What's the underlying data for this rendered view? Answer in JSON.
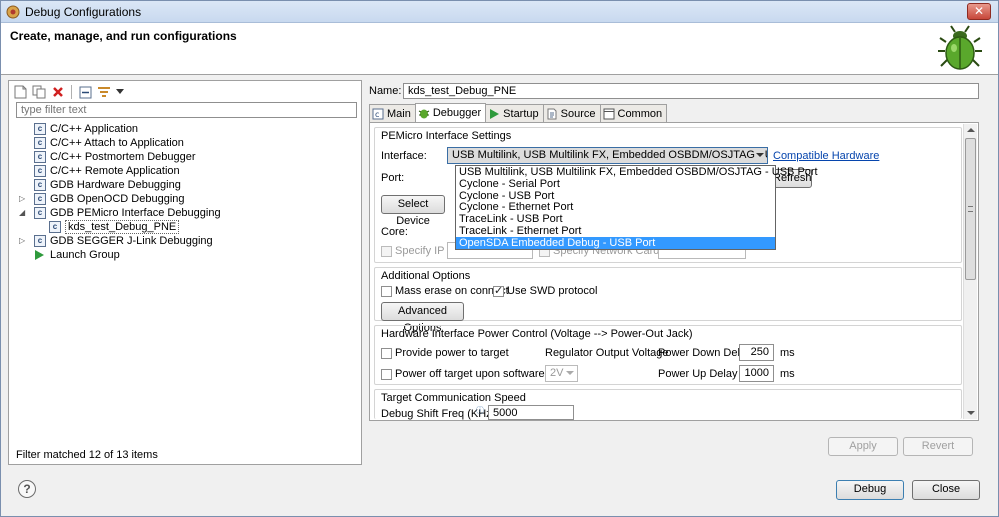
{
  "window": {
    "title": "Debug Configurations"
  },
  "header": {
    "heading": "Create, manage, and run configurations"
  },
  "left": {
    "filter_placeholder": "type filter text",
    "tree": [
      {
        "label": "C/C++ Application",
        "icon": "c-config-icon"
      },
      {
        "label": "C/C++ Attach to Application",
        "icon": "c-config-icon"
      },
      {
        "label": "C/C++ Postmortem Debugger",
        "icon": "c-config-icon"
      },
      {
        "label": "C/C++ Remote Application",
        "icon": "c-config-icon"
      },
      {
        "label": "GDB Hardware Debugging",
        "icon": "c-config-icon"
      },
      {
        "label": "GDB OpenOCD Debugging",
        "icon": "c-config-icon"
      },
      {
        "label": "GDB PEMicro Interface Debugging",
        "icon": "c-config-icon"
      },
      {
        "label": "kds_test_Debug_PNE",
        "icon": "c-config-icon"
      },
      {
        "label": "GDB SEGGER J-Link Debugging",
        "icon": "c-config-icon"
      },
      {
        "label": "Launch Group",
        "icon": "launch-group-icon"
      }
    ],
    "status": "Filter matched 12 of 13 items"
  },
  "right": {
    "name_label": "Name:",
    "name_value": "kds_test_Debug_PNE",
    "tabs": [
      {
        "label": "Main",
        "icon": "main-tab-icon"
      },
      {
        "label": "Debugger",
        "icon": "debugger-tab-icon"
      },
      {
        "label": "Startup",
        "icon": "startup-tab-icon"
      },
      {
        "label": "Source",
        "icon": "source-tab-icon"
      },
      {
        "label": "Common",
        "icon": "common-tab-icon"
      }
    ],
    "pemicro": {
      "title": "PEMicro Interface Settings",
      "interface_label": "Interface:",
      "interface_value": "USB Multilink, USB Multilink FX, Embedded OSBDM/OSJTAG - USB Port",
      "compatible_link": "Compatible Hardware",
      "port_label": "Port:",
      "refresh": "Refresh",
      "select_device": "Select Device",
      "core_label": "Core:",
      "specify_ip": "Specify IP",
      "specify_network_card_ip": "Specify Network Card IP",
      "dropdown_options": [
        "USB Multilink, USB Multilink FX, Embedded OSBDM/OSJTAG - USB Port",
        "Cyclone - Serial Port",
        "Cyclone - USB Port",
        "Cyclone - Ethernet Port",
        "TraceLink - USB Port",
        "TraceLink - Ethernet Port",
        "OpenSDA Embedded Debug - USB Port"
      ]
    },
    "additional": {
      "title": "Additional Options",
      "mass_erase": "Mass erase on connect",
      "use_swd": "Use SWD protocol",
      "advanced_button": "Advanced Options"
    },
    "power": {
      "title": "Hardware Interface Power Control (Voltage --> Power-Out Jack)",
      "provide_power": "Provide power to target",
      "regulator_label": "Regulator Output Voltage",
      "power_down_label": "Power Down Delay",
      "power_down_value": "250",
      "power_down_unit": "ms",
      "power_off": "Power off target upon software exit",
      "voltage_value": "2V",
      "power_up_label": "Power Up Delay",
      "power_up_value": "1000",
      "power_up_unit": "ms"
    },
    "comm": {
      "title": "Target Communication Speed",
      "shift_label": "Debug Shift Freq (KHz)",
      "shift_value": "5000"
    },
    "apply": "Apply",
    "revert": "Revert"
  },
  "footer": {
    "debug": "Debug",
    "close": "Close"
  }
}
